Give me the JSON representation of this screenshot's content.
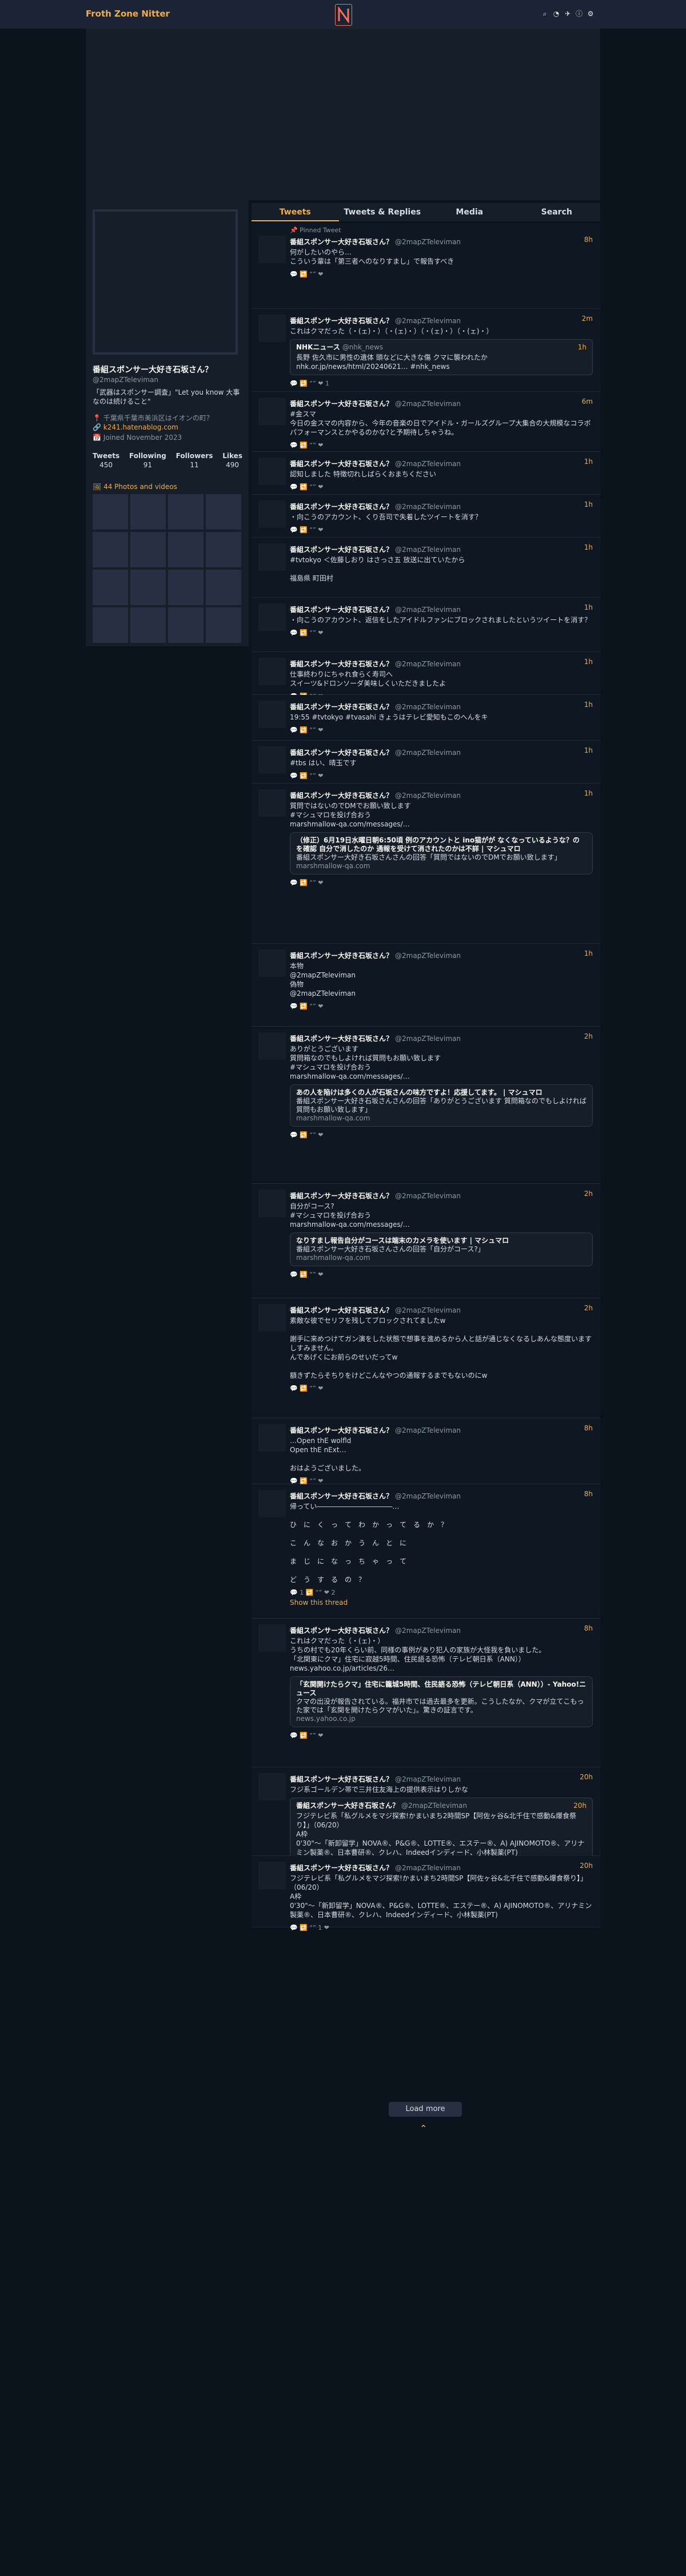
{
  "app": {
    "brand": "Froth Zone Nitter"
  },
  "nav_icons": [
    "search-icon",
    "rss-icon",
    "bird-icon",
    "info-icon",
    "gear-icon"
  ],
  "profile": {
    "name": "番組スポンサー大好き石坂さん？",
    "handle": "@2mapZTeleviman",
    "bio": "「武器はスポンサー調査」\"Let you know 大事なのは続けること\"",
    "location": "千葉県千葉市美浜区はイオンの町？",
    "website": "k241.hatenablog.com",
    "joined": "Joined November 2023",
    "stats": [
      {
        "label": "Tweets",
        "value": "450"
      },
      {
        "label": "Following",
        "value": "91"
      },
      {
        "label": "Followers",
        "value": "11"
      },
      {
        "label": "Likes",
        "value": "490"
      }
    ],
    "photos_label": "44 Photos and videos"
  },
  "tabs": [
    "Tweets",
    "Tweets & Replies",
    "Media",
    "Search"
  ],
  "tweets": [
    {
      "pinned": "Pinned Tweet",
      "name": "番組スポンサー大好き石坂さん？",
      "handle": "@2mapZTeleviman",
      "date": "8h",
      "text": "何がしたいのやら…\nこういう輩は「第三者へのなりすまし」で報告すべき",
      "stats": "💬  🔁  “”  ❤"
    },
    {
      "name": "番組スポンサー大好き石坂さん？",
      "handle": "@2mapZTeleviman",
      "date": "2m",
      "text": "これはクマだった（・(ェ)・）（・(ェ)・）（・(ェ)・）（・(ェ)・）",
      "quote_name": "NHKニュース",
      "quote_handle": "@nhk_news",
      "quote_date": "1h",
      "quote_text": "長野 佐久市に男性の遺体 頭などに大きな傷 クマに襲われたか\nnhk.or.jp/news/html/20240621… #nhk_news",
      "stats": "💬  🔁  “”  ❤ 1"
    },
    {
      "name": "番組スポンサー大好き石坂さん？",
      "handle": "@2mapZTeleviman",
      "date": "6m",
      "text": "#金スマ\n今日の金スマの内容から、今年の音楽の日でアイドル・ガールズグループ大集合の大規模なコラボパフォーマンスとかやるのかな?と予期待しちゃうね。",
      "stats": "💬  🔁  “”  ❤"
    },
    {
      "name": "番組スポンサー大好き石坂さん？",
      "handle": "@2mapZTeleviman",
      "date": "1h",
      "text": "認知しました 特徴切れしばらくおまちください",
      "stats": "💬  🔁  “”  ❤"
    },
    {
      "name": "番組スポンサー大好き石坂さん？",
      "handle": "@2mapZTeleviman",
      "date": "1h",
      "text": "・向こうのアカウント、くり吾司で失着したツイートを消す？",
      "stats": "💬  🔁  “”  ❤"
    },
    {
      "name": "番組スポンサー大好き石坂さん？",
      "handle": "@2mapZTeleviman",
      "date": "1h",
      "text": "#tvtokyo ＜佐藤しおり はさっさ五 放送に出ていたから\n\n福島県 町田村",
      "stats": ""
    },
    {
      "name": "番組スポンサー大好き石坂さん？",
      "handle": "@2mapZTeleviman",
      "date": "1h",
      "text": "・向こうのアカウント、返信をしたアイドルファンにブロックされましたというツイートを消す？",
      "stats": "💬  🔁  “”  ❤"
    },
    {
      "name": "番組スポンサー大好き石坂さん？",
      "handle": "@2mapZTeleviman",
      "date": "1h",
      "text": "仕事終わりにちゃれ食らく寿司へ\nスイーツ&ドロンソーダ美味しくいただきましたよ",
      "stats": "💬  🔁  “”  ❤"
    },
    {
      "name": "番組スポンサー大好き石坂さん？",
      "handle": "@2mapZTeleviman",
      "date": "1h",
      "text": "19:55 #tvtokyo #tvasahi きょうはテレビ愛知もこのへんをキ",
      "stats": "💬  🔁  “”  ❤"
    },
    {
      "name": "番組スポンサー大好き石坂さん？",
      "handle": "@2mapZTeleviman",
      "date": "1h",
      "text": "#tbs はい、晴玉です",
      "stats": "💬  🔁  “”  ❤"
    },
    {
      "name": "番組スポンサー大好き石坂さん？",
      "handle": "@2mapZTeleviman",
      "date": "1h",
      "text": "質問ではないのでDMでお願い致します\n#マシュマロを投げ合おう\nmarshmallow-qa.com/messages/…",
      "card_title": "（修正）6月19日水曜日朝6:50頃 例のアカウントと ino猫がが なくなっているような？の を確認 自分で消したのか 通報を受けて消されたのかは不詳 | マシュマロ",
      "card_desc": "番組スポンサー大好き石坂さんさんの回答「質問ではないのでDMでお願い致します」",
      "card_domain": "marshmallow-qa.com",
      "stats": "💬  🔁  “”  ❤"
    },
    {
      "name": "番組スポンサー大好き石坂さん？",
      "handle": "@2mapZTeleviman",
      "date": "1h",
      "text": "本物\n@2mapZTeleviman\n偽物\n@2mapZTeleviman",
      "stats": "💬  🔁  “”  ❤"
    },
    {
      "name": "番組スポンサー大好き石坂さん？",
      "handle": "@2mapZTeleviman",
      "date": "2h",
      "text": "ありがとうございます\n質問箱なのでもしよければ質問もお願い致します\n#マシュマロを投げ合おう\nmarshmallow-qa.com/messages/…",
      "card_title": "あの人を陥けは多くの人が石坂さんの味方ですよ！応援してます。 | マシュマロ",
      "card_desc": "番組スポンサー大好き石坂さんさんの回答「ありがとうございます 質問箱なのでもしよければ質問もお願い致します」",
      "card_domain": "marshmallow-qa.com",
      "stats": "💬  🔁  “”  ❤"
    },
    {
      "name": "番組スポンサー大好き石坂さん？",
      "handle": "@2mapZTeleviman",
      "date": "2h",
      "text": "自分がコース?\n#マシュマロを投げ合おう\nmarshmallow-qa.com/messages/…",
      "card_title": "なりすまし報告自分がコースは端末のカメラを使います | マシュマロ",
      "card_desc": "番組スポンサー大好き石坂さんさんの回答「自分がコース?」",
      "card_domain": "marshmallow-qa.com",
      "stats": "💬  🔁  “”  ❤"
    },
    {
      "name": "番組スポンサー大好き石坂さん？",
      "handle": "@2mapZTeleviman",
      "date": "2h",
      "text": "素敵な彼でセリフを残してブロックされてましたw\n\n謝手に来めつけてガン演をした状態で想事を進めるから人と話が通じなくなるしあんな態度いますしすみません。\nんであげくにお前らのせいだってw\n\n額きずたらそちりをけどこんなやつの通報するまでもないのにw",
      "stats": "💬  🔁  “”  ❤"
    },
    {
      "name": "番組スポンサー大好き石坂さん？",
      "handle": "@2mapZTeleviman",
      "date": "8h",
      "text": "…Open thE wolfld\nOpen thE nExt…\n\nおはようございました。",
      "stats": "💬  🔁  “”  ❤",
      "show_thread": "Show this thread"
    },
    {
      "name": "番組スポンサー大好き石坂さん？",
      "handle": "@2mapZTeleviman",
      "date": "8h",
      "text": "帰ってい―――――――――――…\n\nひ　に　く　っ　て　わ　か　っ　て　る　か　？\n\nこ　ん　な　お　か　う　ん　と　に\n\nま　じ　に　な　っ　ち　ゃ　っ　て\n\nど　う　す　る　の　？",
      "stats": "💬 1  🔁  “”  ❤ 2",
      "show_thread": "Show this thread"
    },
    {
      "name": "番組スポンサー大好き石坂さん？",
      "handle": "@2mapZTeleviman",
      "date": "8h",
      "text": "これはクマだった（・(ェ)・）\nうちの村でも20年くらい前、同様の事例があり犯人の家族が大怪我を負いました。\n「北関東にクマ」住宅に寂越5時間、住民語る恐怖（テレビ朝日系（ANN））\nnews.yahoo.co.jp/articles/26…",
      "card_title": "「玄関開けたらクマ」住宅に籠城5時間、住民語る恐怖（テレビ朝日系（ANN））- Yahoo!ニュース",
      "card_desc": "クマの出没が報告されている。福井市では過去最多を更新。こうしたなか、クマが立てこもった家では「玄関を開けたらクマがいた」。驚きの証言です。",
      "card_domain": "news.yahoo.co.jp",
      "stats": "💬  🔁  “”  ❤"
    },
    {
      "name": "番組スポンサー大好き石坂さん？",
      "handle": "@2mapZTeleviman",
      "date": "20h",
      "text": "フジ系ゴールデン帯で三井住友海上の提供表示はりしかな",
      "quote_name": "番組スポンサー大好き石坂さん？",
      "quote_handle": "@2mapZTeleviman",
      "quote_date": "20h",
      "quote_text": "フジテレビ系「私グルメをマジ探索!かまいまち2時間SP【阿佐ヶ谷&北千住で感動&爆食祭り】」（06/20）\nA枠\n0'30\"～「新卸留学」NOVA®、P&G®、LOTTE®、エステー®、A) AJINOMOTO®、アリナミン製薬®、日本曹研®、クレハ、Indeedインディード、小林製薬(PT)",
      "stats": ""
    },
    {
      "name": "番組スポンサー大好き石坂さん？",
      "handle": "@2mapZTeleviman",
      "date": "20h",
      "text": "フジテレビ系「私グルメをマジ探索!かまいまち2時間SP【阿佐ヶ谷&北千住で感動&爆食祭り】」（06/20）\nA枠\n0'30\"～「新卸留学」NOVA®、P&G®、LOTTE®、エステー®、A) AJINOMOTO®、アリナミン製薬®、日本曹研®、クレハ、Indeedインディード、小林製薬(PT)",
      "stats": "💬  🔁  “” 1  ❤"
    }
  ],
  "load_more": "Load more"
}
